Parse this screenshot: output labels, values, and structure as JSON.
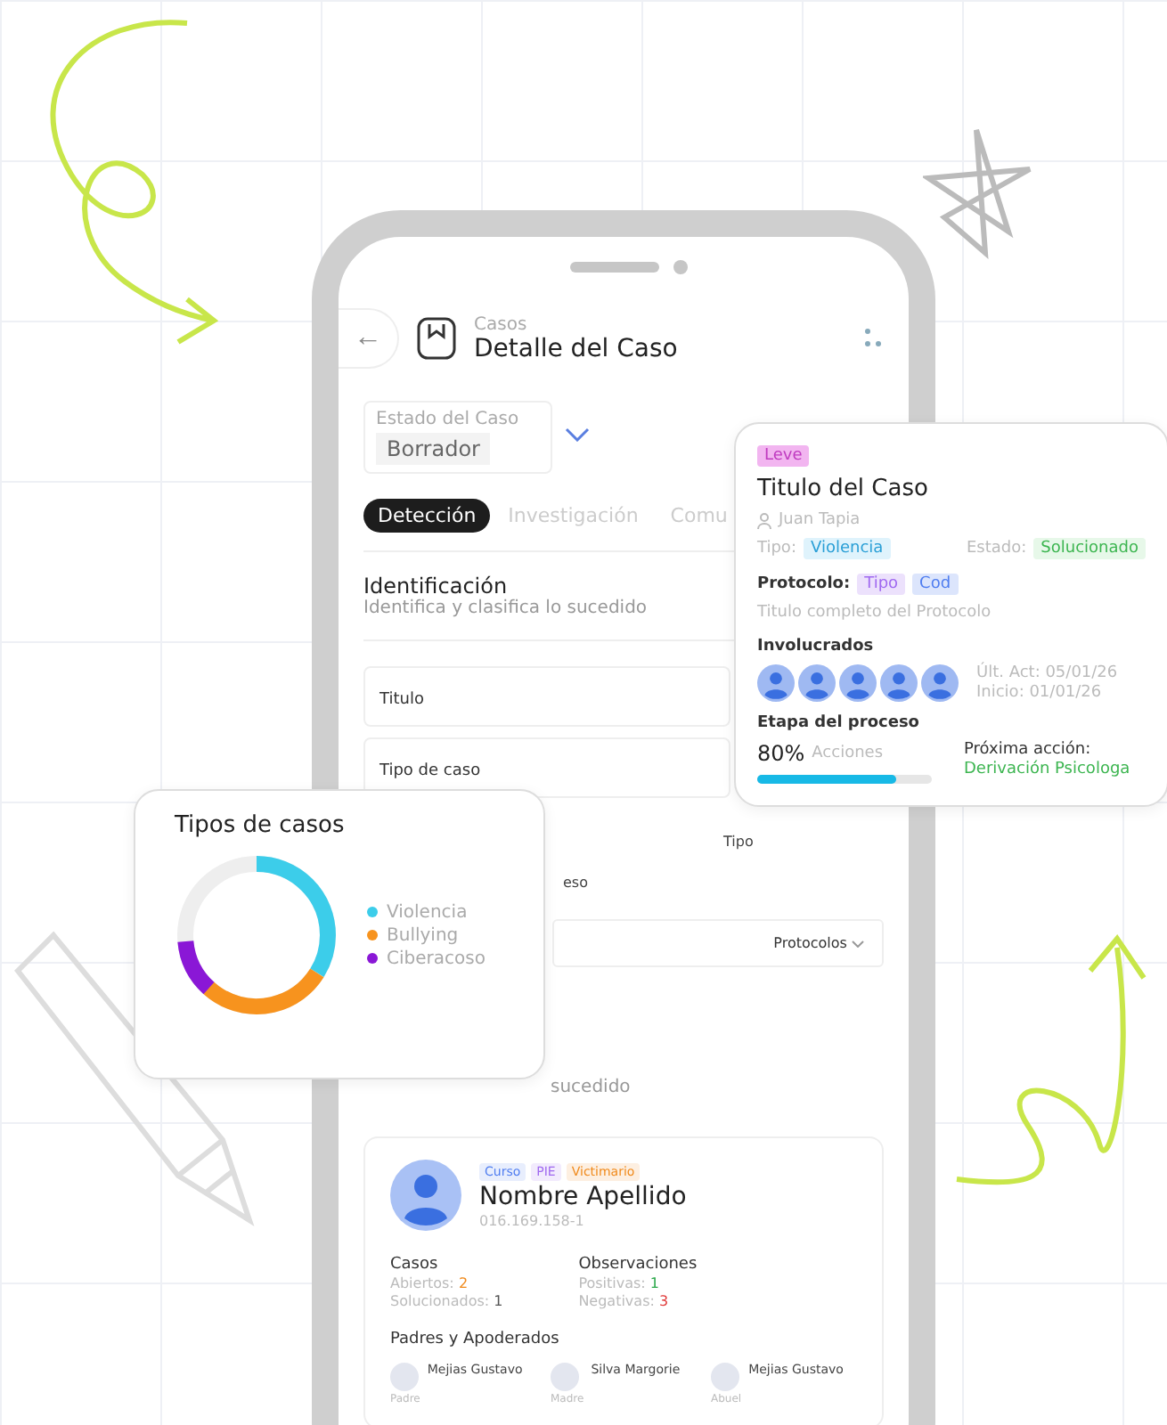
{
  "header": {
    "back": "←",
    "section": "Casos",
    "title": "Detalle del Caso"
  },
  "status_select": {
    "label": "Estado del Caso",
    "value": "Borrador"
  },
  "tabs": [
    {
      "label": "Detección",
      "selected": true
    },
    {
      "label": "Investigación",
      "selected": false
    },
    {
      "label": "Comu",
      "selected": false
    }
  ],
  "identification": {
    "title": "Identificación",
    "subtitle": "Identifica y clasifica lo sucedido",
    "fields": [
      {
        "label": "Titulo"
      },
      {
        "label": "Tipo de caso"
      }
    ],
    "fragments": [
      "Tipo",
      "eso"
    ],
    "protocol_select": "Protocolos",
    "section_fragment": "sucedido"
  },
  "person": {
    "tags": [
      {
        "label": "Curso",
        "color": "#4f7df0"
      },
      {
        "label": "PIE",
        "color": "#a06af0"
      },
      {
        "label": "Victimario",
        "color": "#f08a1c"
      }
    ],
    "name": "Nombre Apellido",
    "rut": "016.169.158-1",
    "cases_title": "Casos",
    "cases": [
      {
        "label": "Abiertos:",
        "value": "2",
        "color": "#f08a1c"
      },
      {
        "label": "Solucionados:",
        "value": "1",
        "color": "#555555"
      }
    ],
    "obs_title": "Observaciones",
    "observations": [
      {
        "label": "Positivas:",
        "value": "1",
        "color": "#2aa84a"
      },
      {
        "label": "Negativas:",
        "value": "3",
        "color": "#e03a3a"
      }
    ],
    "guardians_title": "Padres y Apoderados",
    "guardians": [
      {
        "name": "Mejias Gustavo",
        "relation": "Padre"
      },
      {
        "name": "Silva Margorie",
        "relation": "Madre"
      },
      {
        "name": "Mejias Gustavo",
        "relation": "Abuel"
      }
    ]
  },
  "case_card": {
    "severity": "Leve",
    "title": "Titulo del Caso",
    "owner": "Juan Tapia",
    "type_label": "Tipo:",
    "type": "Violencia",
    "state_label": "Estado:",
    "state": "Solucionado",
    "protocol_label": "Protocolo:",
    "protocol_tags": [
      {
        "label": "Tipo",
        "color": "#a06af0"
      },
      {
        "label": "Cod",
        "color": "#4f7df0"
      }
    ],
    "protocol_title": "Titulo completo del Protocolo",
    "involved_title": "Involucrados",
    "involved": [
      {
        "kind": "avatar"
      },
      {
        "kind": "avatar"
      },
      {
        "kind": "avatar"
      },
      {
        "kind": "avatar"
      },
      {
        "kind": "avatar"
      }
    ],
    "updated": "Últ. Act: 05/01/26",
    "started": "Inicio: 01/01/26",
    "stage_title": "Etapa del proceso",
    "percent": "80%",
    "percent_label": "Acciones",
    "level": 0.8,
    "next_title": "Próxima acción:",
    "next": "Derivación Psicologa"
  },
  "chart_card": {
    "title": "Tipos de casos",
    "legend": [
      {
        "label": "Violencia",
        "color": "#3ccdea"
      },
      {
        "label": "Bullying",
        "color": "#f7931e"
      },
      {
        "label": "Ciberacoso",
        "color": "#8a17d6"
      }
    ]
  }
}
